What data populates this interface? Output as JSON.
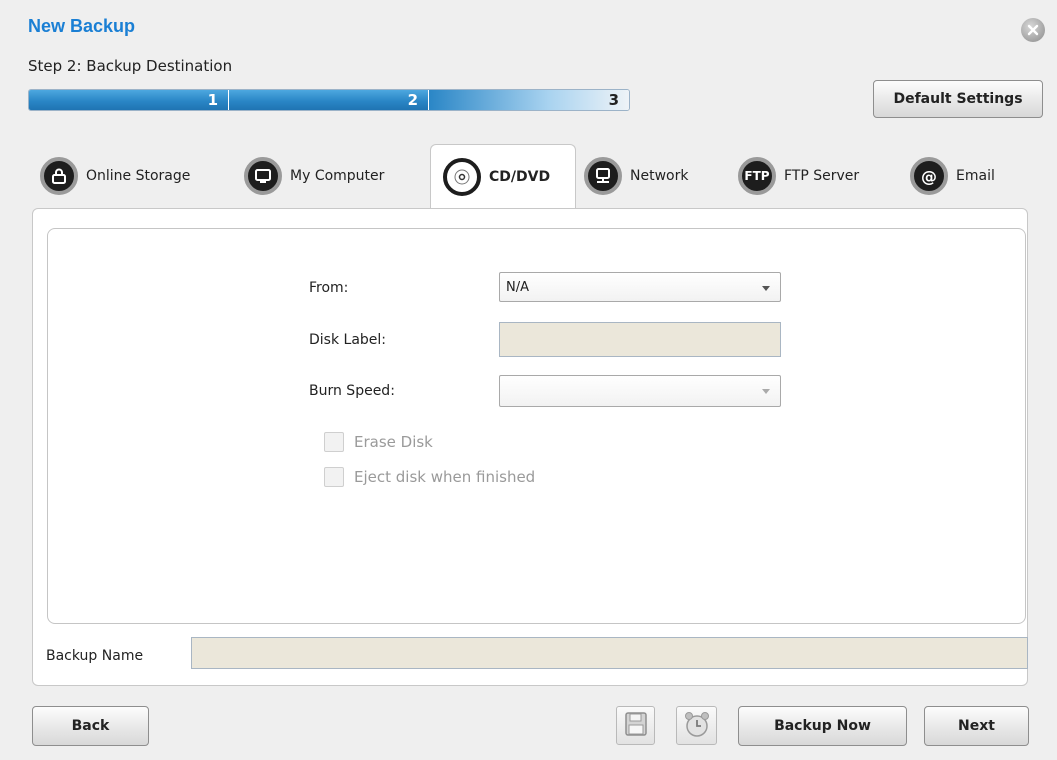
{
  "window": {
    "title": "New Backup",
    "step_label": "Step 2: Backup Destination"
  },
  "progress": {
    "steps": [
      "1",
      "2",
      "3"
    ],
    "current_step": 2
  },
  "header": {
    "default_settings_label": "Default Settings"
  },
  "tabs": [
    {
      "label": "Online Storage",
      "icon": "lock-icon"
    },
    {
      "label": "My Computer",
      "icon": "monitor-icon"
    },
    {
      "label": "CD/DVD",
      "icon": "disc-icon",
      "active": true
    },
    {
      "label": "Network",
      "icon": "network-computer-icon"
    },
    {
      "label": "FTP Server",
      "icon": "ftp-icon",
      "icon_text": "FTP"
    },
    {
      "label": "Email",
      "icon": "at-sign-icon",
      "icon_text": "@"
    }
  ],
  "form": {
    "from_label": "From:",
    "from_value": "N/A",
    "disk_label_label": "Disk Label:",
    "disk_label_value": "",
    "burn_speed_label": "Burn Speed:",
    "burn_speed_value": "",
    "erase_disk_label": "Erase Disk",
    "erase_disk_checked": false,
    "eject_disk_label": "Eject disk when finished",
    "eject_disk_checked": false
  },
  "backup_name": {
    "label": "Backup Name",
    "value": ""
  },
  "footer": {
    "back_label": "Back",
    "backup_now_label": "Backup Now",
    "next_label": "Next",
    "save_icon": "floppy-disk-icon",
    "schedule_icon": "alarm-clock-icon"
  },
  "colors": {
    "title": "#1a7fd4",
    "progress_fill": "#2a86c6",
    "field_bg": "#ebe7da"
  }
}
